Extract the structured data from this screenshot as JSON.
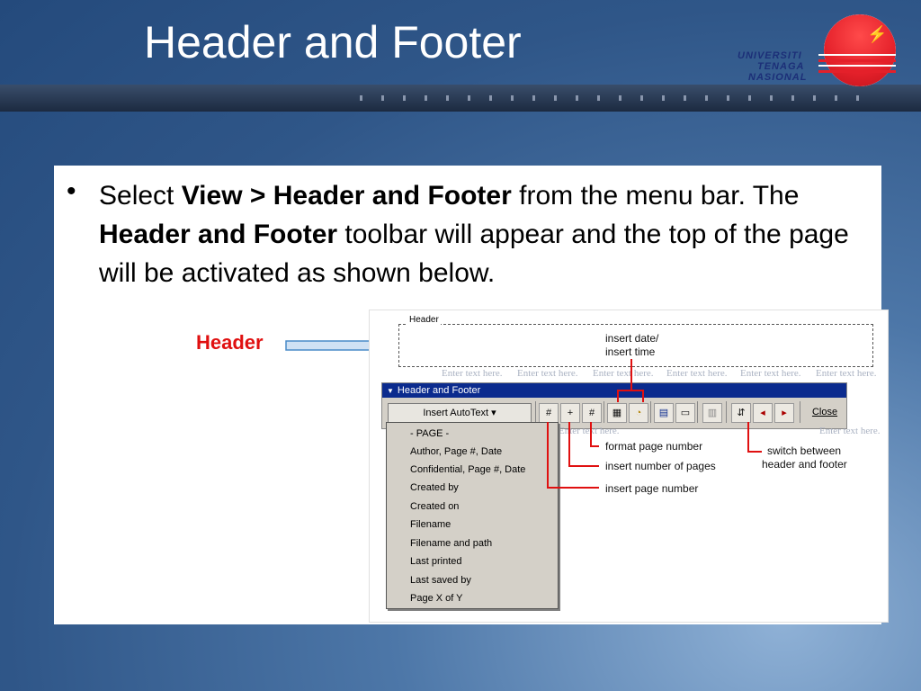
{
  "slide": {
    "title": "Header and Footer"
  },
  "logo": {
    "line1": "UNIVERSITI",
    "line2": "TENAGA",
    "line3": "NASIONAL"
  },
  "bullet": {
    "symbol": "•",
    "seg1": "Select ",
    "bold1": "View > Header and Footer",
    "seg2": " from the menu bar. The ",
    "bold2": "Header and Footer",
    "seg3": " toolbar will appear and the top of the page will be activated as shown below."
  },
  "callout": {
    "label": "Header"
  },
  "screenshot": {
    "header_tag": "Header",
    "ghost_text": "Enter text here.",
    "toolbar_title": "Header and Footer",
    "insert_autotext": "Insert AutoText ▾",
    "close_label": "Close",
    "annotations": {
      "insert_date": "insert date/",
      "insert_time": "insert time",
      "format_page_number": "format page number",
      "insert_number_of_pages": "insert number of pages",
      "insert_page_number": "insert page number",
      "switch1": "switch between",
      "switch2": "header and footer"
    },
    "menu_items": [
      "- PAGE -",
      "Author, Page #, Date",
      "Confidential, Page #, Date",
      "Created by",
      "Created on",
      "Filename",
      "Filename and path",
      "Last printed",
      "Last saved by",
      "Page X of Y"
    ]
  },
  "colors": {
    "accent_red": "#e01010",
    "toolbar_blue": "#0b2b8e"
  }
}
